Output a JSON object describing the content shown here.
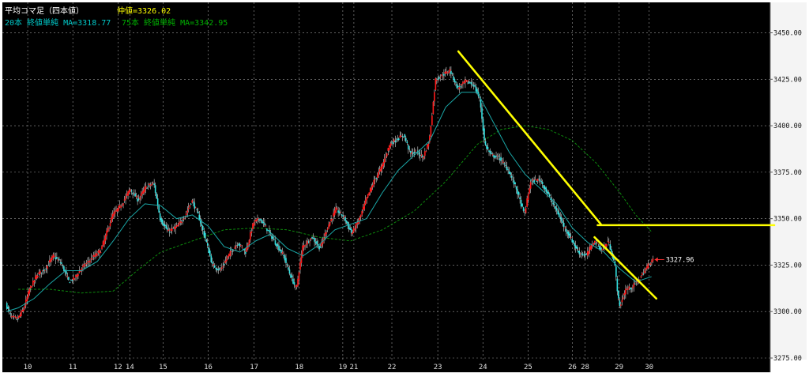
{
  "chart_data": {
    "type": "candlestick",
    "title": "平均コマ足（四本値）",
    "median_label": "仲値=3326.02",
    "legend": [
      {
        "text": "20本 終値単純 MA=3318.77",
        "color": "#00c8c8"
      },
      {
        "text": "75本 終値単純 MA=3342.95",
        "color": "#00b000"
      }
    ],
    "ylim": [
      3275,
      3460
    ],
    "yticks": [
      3275,
      3300,
      3325,
      3350,
      3375,
      3400,
      3425,
      3450
    ],
    "ytick_labels": [
      "3275.00",
      "3300.00",
      "3325.00",
      "3350.00",
      "3375.00",
      "3400.00",
      "3425.00",
      "3450.00"
    ],
    "x_range": [
      0,
      970
    ],
    "xticks": [
      {
        "label": "10",
        "x": 32
      },
      {
        "label": "11",
        "x": 89
      },
      {
        "label": "12",
        "x": 146
      },
      {
        "label": "14",
        "x": 161
      },
      {
        "label": "15",
        "x": 203
      },
      {
        "label": "16",
        "x": 260
      },
      {
        "label": "17",
        "x": 318
      },
      {
        "label": "18",
        "x": 375
      },
      {
        "label": "19",
        "x": 430
      },
      {
        "label": "21",
        "x": 444
      },
      {
        "label": "22",
        "x": 492
      },
      {
        "label": "23",
        "x": 550
      },
      {
        "label": "24",
        "x": 607
      },
      {
        "label": "25",
        "x": 664
      },
      {
        "label": "26",
        "x": 720
      },
      {
        "label": "28",
        "x": 736
      },
      {
        "label": "29",
        "x": 779
      },
      {
        "label": "30",
        "x": 817
      }
    ],
    "price_path": [
      [
        5,
        3304
      ],
      [
        12,
        3297
      ],
      [
        20,
        3296
      ],
      [
        28,
        3302
      ],
      [
        35,
        3312
      ],
      [
        45,
        3320
      ],
      [
        55,
        3323
      ],
      [
        65,
        3330
      ],
      [
        75,
        3326
      ],
      [
        85,
        3316
      ],
      [
        92,
        3318
      ],
      [
        100,
        3323
      ],
      [
        112,
        3328
      ],
      [
        125,
        3333
      ],
      [
        140,
        3352
      ],
      [
        152,
        3358
      ],
      [
        162,
        3366
      ],
      [
        172,
        3360
      ],
      [
        182,
        3367
      ],
      [
        192,
        3369
      ],
      [
        200,
        3350
      ],
      [
        210,
        3343
      ],
      [
        222,
        3346
      ],
      [
        232,
        3352
      ],
      [
        240,
        3360
      ],
      [
        248,
        3352
      ],
      [
        258,
        3338
      ],
      [
        266,
        3325
      ],
      [
        276,
        3322
      ],
      [
        286,
        3330
      ],
      [
        298,
        3337
      ],
      [
        308,
        3332
      ],
      [
        318,
        3348
      ],
      [
        326,
        3350
      ],
      [
        334,
        3345
      ],
      [
        344,
        3338
      ],
      [
        356,
        3330
      ],
      [
        364,
        3320
      ],
      [
        372,
        3312
      ],
      [
        380,
        3335
      ],
      [
        392,
        3340
      ],
      [
        402,
        3334
      ],
      [
        412,
        3346
      ],
      [
        422,
        3355
      ],
      [
        432,
        3351
      ],
      [
        442,
        3342
      ],
      [
        452,
        3350
      ],
      [
        460,
        3360
      ],
      [
        470,
        3370
      ],
      [
        480,
        3378
      ],
      [
        490,
        3390
      ],
      [
        500,
        3393
      ],
      [
        508,
        3395
      ],
      [
        516,
        3385
      ],
      [
        524,
        3386
      ],
      [
        532,
        3383
      ],
      [
        540,
        3392
      ],
      [
        548,
        3425
      ],
      [
        556,
        3427
      ],
      [
        566,
        3430
      ],
      [
        576,
        3420
      ],
      [
        586,
        3424
      ],
      [
        596,
        3422
      ],
      [
        604,
        3414
      ],
      [
        610,
        3390
      ],
      [
        618,
        3384
      ],
      [
        628,
        3383
      ],
      [
        640,
        3376
      ],
      [
        650,
        3366
      ],
      [
        660,
        3352
      ],
      [
        668,
        3370
      ],
      [
        680,
        3371
      ],
      [
        690,
        3363
      ],
      [
        700,
        3355
      ],
      [
        710,
        3346
      ],
      [
        718,
        3340
      ],
      [
        728,
        3332
      ],
      [
        738,
        3330
      ],
      [
        748,
        3338
      ],
      [
        758,
        3333
      ],
      [
        766,
        3338
      ],
      [
        774,
        3326
      ],
      [
        780,
        3302
      ],
      [
        788,
        3312
      ],
      [
        796,
        3313
      ],
      [
        806,
        3318
      ],
      [
        812,
        3322
      ],
      [
        818,
        3326
      ],
      [
        822,
        3327.96
      ]
    ],
    "series": [
      {
        "name": "20本 終値単純 MA",
        "color": "#1aa7a7",
        "points": [
          [
            5,
            3300
          ],
          [
            20,
            3302
          ],
          [
            40,
            3307
          ],
          [
            60,
            3315
          ],
          [
            80,
            3322
          ],
          [
            100,
            3322
          ],
          [
            120,
            3327
          ],
          [
            140,
            3338
          ],
          [
            160,
            3350
          ],
          [
            180,
            3358
          ],
          [
            200,
            3357
          ],
          [
            220,
            3350
          ],
          [
            240,
            3352
          ],
          [
            260,
            3346
          ],
          [
            280,
            3335
          ],
          [
            300,
            3332
          ],
          [
            320,
            3338
          ],
          [
            340,
            3342
          ],
          [
            360,
            3334
          ],
          [
            380,
            3330
          ],
          [
            400,
            3336
          ],
          [
            420,
            3344
          ],
          [
            440,
            3347
          ],
          [
            460,
            3350
          ],
          [
            480,
            3364
          ],
          [
            500,
            3376
          ],
          [
            520,
            3384
          ],
          [
            540,
            3392
          ],
          [
            560,
            3410
          ],
          [
            580,
            3418
          ],
          [
            600,
            3418
          ],
          [
            620,
            3402
          ],
          [
            640,
            3386
          ],
          [
            660,
            3374
          ],
          [
            680,
            3366
          ],
          [
            700,
            3358
          ],
          [
            720,
            3345
          ],
          [
            740,
            3337
          ],
          [
            760,
            3332
          ],
          [
            780,
            3323
          ],
          [
            800,
            3316
          ],
          [
            820,
            3318.77
          ]
        ]
      },
      {
        "name": "75本 終値単純 MA",
        "color": "#0d8a0d",
        "dashed": true,
        "points": [
          [
            20,
            3312
          ],
          [
            60,
            3312
          ],
          [
            100,
            3310
          ],
          [
            140,
            3311
          ],
          [
            170,
            3322
          ],
          [
            200,
            3332
          ],
          [
            240,
            3338
          ],
          [
            280,
            3344
          ],
          [
            320,
            3345
          ],
          [
            360,
            3344
          ],
          [
            400,
            3340
          ],
          [
            440,
            3338
          ],
          [
            480,
            3344
          ],
          [
            520,
            3354
          ],
          [
            560,
            3370
          ],
          [
            600,
            3390
          ],
          [
            630,
            3398
          ],
          [
            660,
            3400
          ],
          [
            690,
            3398
          ],
          [
            720,
            3392
          ],
          [
            750,
            3380
          ],
          [
            780,
            3364
          ],
          [
            800,
            3352
          ],
          [
            820,
            3342.95
          ]
        ]
      }
    ],
    "trendlines": [
      {
        "color": "#ffff00",
        "points": [
          [
            576,
            3440
          ],
          [
            756,
            3347
          ]
        ]
      },
      {
        "color": "#ffff00",
        "points": [
          [
            748,
            3340
          ],
          [
            826,
            3307
          ]
        ]
      },
      {
        "color": "#ffff00",
        "points": [
          [
            752,
            3346.5
          ],
          [
            975,
            3346.5
          ]
        ]
      }
    ],
    "last_price": {
      "value": 3327.96,
      "label": "3327.96",
      "color": "#ff3030"
    },
    "candle_colors": {
      "up": "#ff1a1a",
      "down": "#33e0e0",
      "wick": "#ffffff"
    }
  }
}
